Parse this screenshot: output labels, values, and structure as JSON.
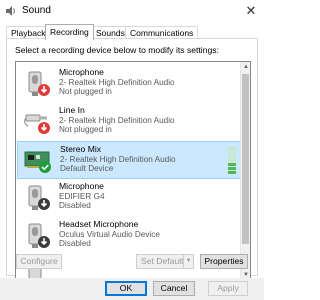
{
  "window": {
    "title": "Sound",
    "close_glyph": "✕"
  },
  "tabs": [
    {
      "label": "Playback",
      "active": false
    },
    {
      "label": "Recording",
      "active": true
    },
    {
      "label": "Sounds",
      "active": false
    },
    {
      "label": "Communications",
      "active": false
    }
  ],
  "instruction": "Select a recording device below to modify its settings:",
  "devices": [
    {
      "name": "Microphone",
      "driver": "2- Realtek High Definition Audio",
      "status": "Not plugged in",
      "icon": "microphone-icon",
      "badge": "down-arrow-red"
    },
    {
      "name": "Line In",
      "driver": "2- Realtek High Definition Audio",
      "status": "Not plugged in",
      "icon": "line-in-icon",
      "badge": "down-arrow-red"
    },
    {
      "name": "Stereo Mix",
      "driver": "2- Realtek High Definition Audio",
      "status": "Default Device",
      "icon": "sound-card-icon",
      "badge": "check-green",
      "selected": true,
      "level_bars": 8,
      "level_on": 4
    },
    {
      "name": "Microphone",
      "driver": "EDIFIER G4",
      "status": "Disabled",
      "icon": "microphone-icon",
      "badge": "down-arrow-dark"
    },
    {
      "name": "Headset Microphone",
      "driver": "Oculus Virtual Audio Device",
      "status": "Disabled",
      "icon": "microphone-icon",
      "badge": "down-arrow-dark"
    }
  ],
  "buttons": {
    "configure": "Configure",
    "set_default": "Set Default",
    "properties": "Properties",
    "ok": "OK",
    "cancel": "Cancel",
    "apply": "Apply"
  },
  "colors": {
    "accent": "#0078d7",
    "selected_bg": "#cce8ff",
    "level_green": "#4db84d",
    "badge_red": "#e03a3a",
    "badge_green": "#1e9e3a"
  }
}
